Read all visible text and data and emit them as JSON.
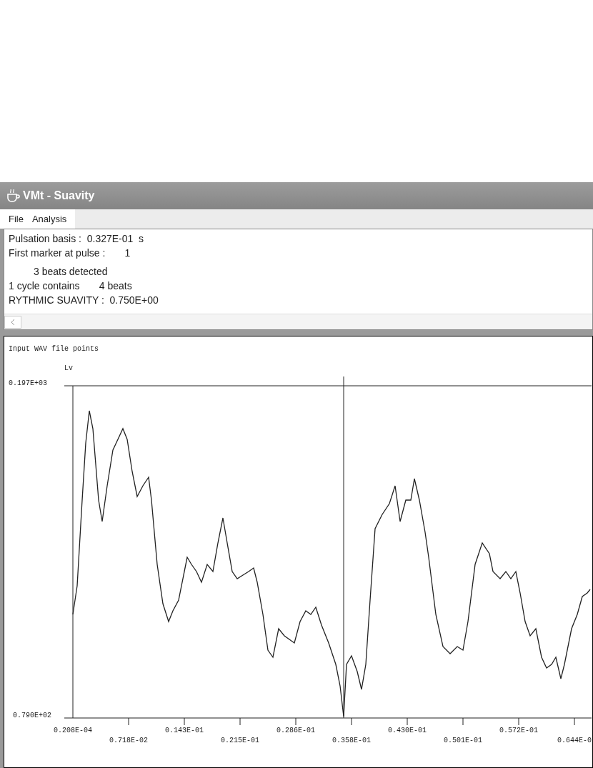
{
  "window": {
    "title": "VMt - Suavity"
  },
  "menu": [
    "File",
    "Analysis"
  ],
  "results": {
    "pulsation_basis": "Pulsation basis :  0.327E-01  s",
    "first_marker": "First marker at pulse :       1",
    "beats_detected": "3 beats detected",
    "cycle": "1 cycle contains       4 beats",
    "suavity": "RYTHMIC SUAVITY :  0.750E+00"
  },
  "plot": {
    "title": "Input WAV file points",
    "y_label": "Lv",
    "y_max": "0.197E+03",
    "y_min": "0.790E+02",
    "x_ticks": [
      "0.208E-04",
      "0.718E-02",
      "0.143E-01",
      "0.215E-01",
      "0.286E-01",
      "0.358E-01",
      "0.430E-01",
      "0.501E-01",
      "0.572E-01",
      "0.644E-0"
    ]
  }
}
